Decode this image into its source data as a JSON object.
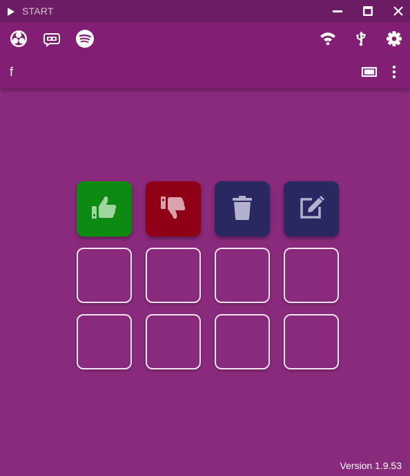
{
  "titlebar": {
    "title": "START",
    "controls": [
      "minimize",
      "maximize",
      "close"
    ]
  },
  "toolbar": {
    "left_icons": [
      "obs-icon",
      "streamlabs-icon",
      "spotify-icon"
    ],
    "right_icons": [
      "wifi-icon",
      "usb-icon",
      "gear-icon"
    ]
  },
  "subbar": {
    "profile_label": "f",
    "right_icons": [
      "screen-icon",
      "more-vert-icon"
    ]
  },
  "grid": {
    "rows": 3,
    "columns": 4,
    "keys": [
      {
        "icon": "thumbs-up-icon",
        "bg": "#0c8a12",
        "icon_color": "#9fd6a0"
      },
      {
        "icon": "thumbs-down-icon",
        "bg": "#8f0017",
        "icon_color": "#d9a3ad"
      },
      {
        "icon": "trash-icon",
        "bg": "#2a2860",
        "icon_color": "#b3b1cf"
      },
      {
        "icon": "edit-icon",
        "bg": "#2a2860",
        "icon_color": "#b3b1cf"
      }
    ]
  },
  "colors": {
    "background": "#8a2a7c",
    "titlebar": "#6c1c62",
    "toolbar": "#821f74",
    "empty_key_border": "#f2e6f0"
  },
  "footer": {
    "version": "Version 1.9.53"
  }
}
